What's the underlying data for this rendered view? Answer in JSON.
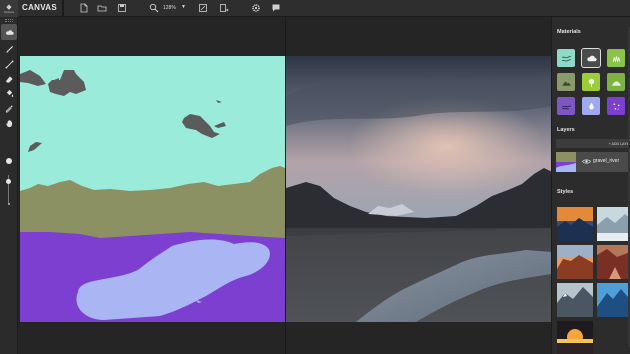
{
  "app": {
    "logo_text": "Hintura",
    "title": "CANVAS"
  },
  "toolbar_top": {
    "icons": [
      "new-file-icon",
      "open-folder-icon",
      "save-icon",
      "zoom-icon",
      "fit-to-screen-icon",
      "export-icon",
      "settings-icon",
      "feedback-icon"
    ],
    "zoom_value": "128%",
    "zoom_caret": "▼"
  },
  "tools": [
    "materials-cloud-icon",
    "brush-icon",
    "line-icon",
    "eraser-icon",
    "fill-bucket-icon",
    "eyedropper-icon",
    "pan-hand-icon"
  ],
  "materials": {
    "heading": "Materials",
    "tiles": [
      {
        "name": "sky",
        "color": "#8fd9c7",
        "icon": "sky-icon",
        "selected": false
      },
      {
        "name": "cloud",
        "color": "#4b4b4b",
        "icon": "cloud-icon",
        "selected": true
      },
      {
        "name": "grass",
        "color": "#8bc34a",
        "icon": "grass-icon",
        "selected": false
      },
      {
        "name": "mountain",
        "color": "#8a9a6a",
        "icon": "mountain-icon",
        "selected": false
      },
      {
        "name": "tree",
        "color": "#9ccc3a",
        "icon": "tree-icon",
        "selected": false
      },
      {
        "name": "hill",
        "color": "#7cb342",
        "icon": "hill-icon",
        "selected": false
      },
      {
        "name": "water",
        "color": "#7e57c2",
        "icon": "water-icon",
        "selected": false
      },
      {
        "name": "river",
        "color": "#9fa8f0",
        "icon": "river-icon",
        "selected": false
      },
      {
        "name": "snow",
        "color": "#7c3fcf",
        "icon": "sparkle-icon",
        "selected": false
      }
    ]
  },
  "layers": {
    "heading": "Layers",
    "add_label": "+ ADD LAYE",
    "items": [
      {
        "name": "gravel_river",
        "visible": true
      }
    ]
  },
  "styles": {
    "heading": "Styles",
    "thumbnails": [
      "style-sunset-lake",
      "style-snow-valley",
      "style-desert-rocks",
      "style-canyon",
      "style-mist-mountains",
      "style-blue-peaks",
      "style-golden-sun"
    ]
  },
  "colors": {
    "sky": "#9aebd9",
    "cloud": "#5b5b5b",
    "ground": "#8c9163",
    "water": "#7c3fcf",
    "river": "#aab6f4"
  }
}
